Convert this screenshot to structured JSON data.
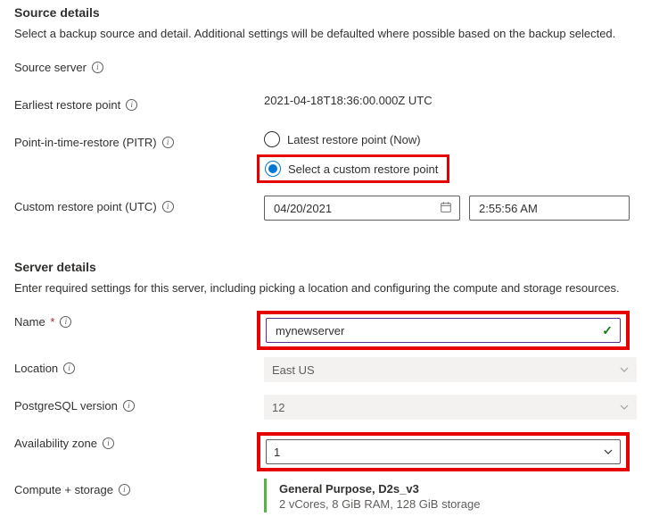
{
  "source": {
    "title": "Source details",
    "desc": "Select a backup source and detail. Additional settings will be defaulted where possible based on the backup selected.",
    "server_label": "Source server",
    "earliest_label": "Earliest restore point",
    "earliest_value": "2021-04-18T18:36:00.000Z UTC",
    "pitr_label": "Point-in-time-restore (PITR)",
    "pitr_option_latest": "Latest restore point (Now)",
    "pitr_option_custom": "Select a custom restore point",
    "custom_label": "Custom restore point (UTC)",
    "custom_date": "04/20/2021",
    "custom_time": "2:55:56 AM"
  },
  "server": {
    "title": "Server details",
    "desc": "Enter required settings for this server, including picking a location and configuring the compute and storage resources.",
    "name_label": "Name",
    "name_value": "mynewserver",
    "location_label": "Location",
    "location_value": "East US",
    "pg_label": "PostgreSQL version",
    "pg_value": "12",
    "az_label": "Availability zone",
    "az_value": "1",
    "compute_label": "Compute + storage",
    "compute_title": "General Purpose, D2s_v3",
    "compute_sub": "2 vCores, 8 GiB RAM, 128 GiB storage"
  }
}
